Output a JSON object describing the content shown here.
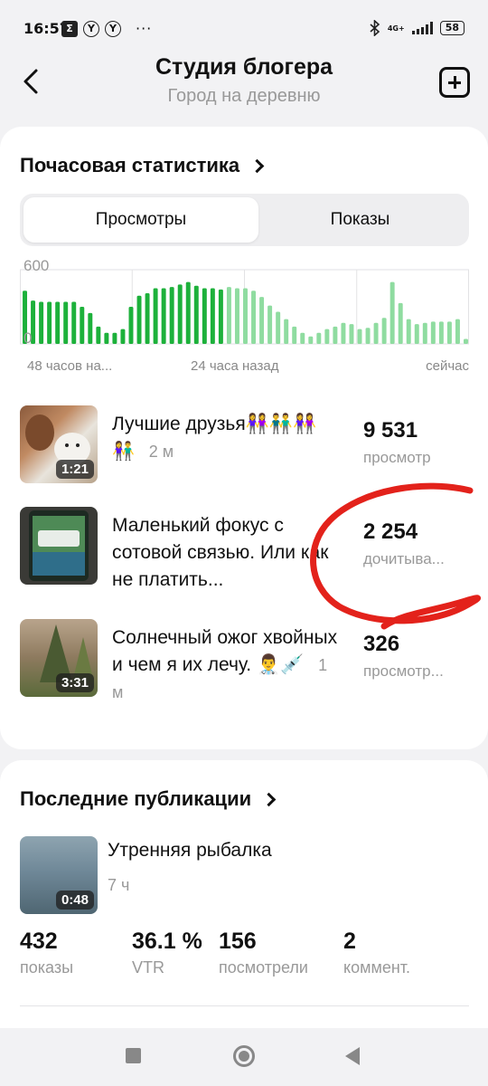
{
  "status_bar": {
    "time": "16:57",
    "notif_icons": [
      "Σ",
      "Y",
      "Y"
    ],
    "more": "···",
    "network": "4G+",
    "battery": "58"
  },
  "header": {
    "title": "Студия блогера",
    "subtitle": "Город на деревню"
  },
  "hourly": {
    "title": "Почасовая статистика",
    "tabs": [
      "Просмотры",
      "Показы"
    ],
    "active_tab": "Просмотры",
    "x_labels": [
      "48 часов на...",
      "24 часа назад",
      "сейчас"
    ]
  },
  "chart_data": {
    "type": "bar",
    "y_ticks": [
      "600",
      "0"
    ],
    "ylim": [
      0,
      600
    ],
    "x_tick_labels": [
      "48 часов на...",
      "24 часа назад",
      "сейчас"
    ],
    "colors": {
      "older": "#1db13b",
      "recent": "#8fdca0"
    },
    "series": [
      {
        "values": [
          430,
          350,
          340,
          340,
          340,
          340,
          340,
          300,
          250,
          140,
          90,
          90,
          120,
          300,
          390,
          410,
          450,
          450,
          460,
          480,
          500,
          470,
          450,
          450,
          440
        ]
      },
      {
        "values": [
          460,
          450,
          450,
          430,
          380,
          310,
          260,
          200,
          140,
          90,
          60,
          90,
          120,
          140,
          170,
          160,
          120,
          130,
          170,
          210,
          500,
          330,
          200,
          160,
          170,
          180,
          180,
          180,
          200,
          40
        ]
      }
    ]
  },
  "videos": [
    {
      "title": "Лучшие друзья👭👬👭",
      "age": "2 м",
      "duration": "1:21",
      "stat_value": "9 531",
      "stat_label": "просмотр"
    },
    {
      "title": "Маленький фокус с сотовой связью. Или как не платить...",
      "age": "",
      "duration": "",
      "stat_value": "2 254",
      "stat_label": "дочитыва..."
    },
    {
      "title": "Солнечный ожог хвойных и чем я их лечу. 👨‍⚕️💉",
      "age": "1 м",
      "duration": "3:31",
      "stat_value": "326",
      "stat_label": "просмотр..."
    }
  ],
  "recent": {
    "title": "Последние публикации",
    "item": {
      "title": "Утренняя рыбалка",
      "time": "7 ч",
      "duration": "0:48"
    },
    "metrics": [
      {
        "value": "432",
        "label": "показы"
      },
      {
        "value": "36.1 %",
        "label": "VTR"
      },
      {
        "value": "156",
        "label": "посмотрели"
      },
      {
        "value": "2",
        "label": "коммент."
      }
    ]
  }
}
